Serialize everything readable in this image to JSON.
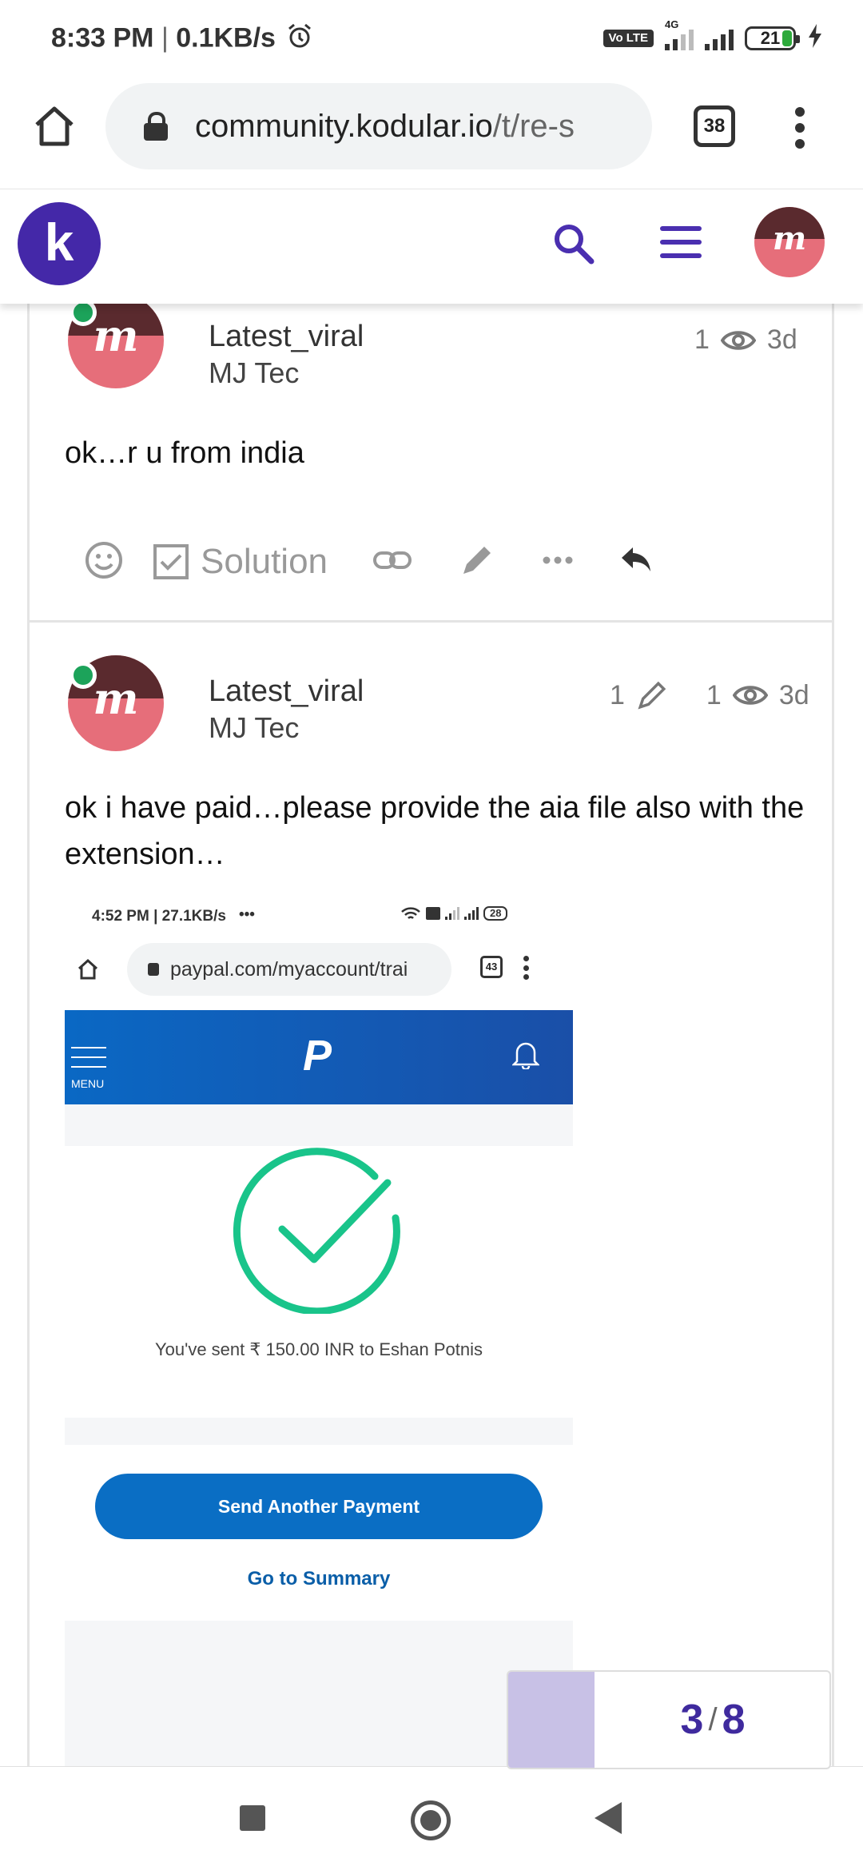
{
  "status_bar": {
    "time": "8:33 PM",
    "speed": "0.1KB/s",
    "network": "4G",
    "volte": "Vo LTE",
    "battery": "21"
  },
  "browser": {
    "url_domain": "community.kodular.io",
    "url_path": "/t/re-s",
    "tab_count": "38"
  },
  "site_header": {
    "logo_letter": "k",
    "avatar_letter": "m"
  },
  "posts": [
    {
      "username": "Latest_viral",
      "fullname": "MJ Tec",
      "views": "1",
      "age": "3d",
      "text": "ok…r u from india",
      "solution_label": "Solution"
    },
    {
      "username": "Latest_viral",
      "fullname": "MJ Tec",
      "edits": "1",
      "views": "1",
      "age": "3d",
      "text": "ok i have paid…please provide the aia file also with the extension…"
    }
  ],
  "embedded_screenshot": {
    "time": "4:52 PM | 27.1KB/s",
    "dots": "•••",
    "battery": "28",
    "url": "paypal.com/myaccount/trai",
    "tab_count": "43",
    "menu_label": "MENU",
    "logo": "P",
    "sent_text": "You've sent ₹ 150.00 INR to Eshan Potnis",
    "send_button": "Send Another Payment",
    "summary_link": "Go to Summary",
    "accent_color": "#19c48a"
  },
  "progress": {
    "current": "3",
    "separator": "/",
    "total": "8"
  }
}
